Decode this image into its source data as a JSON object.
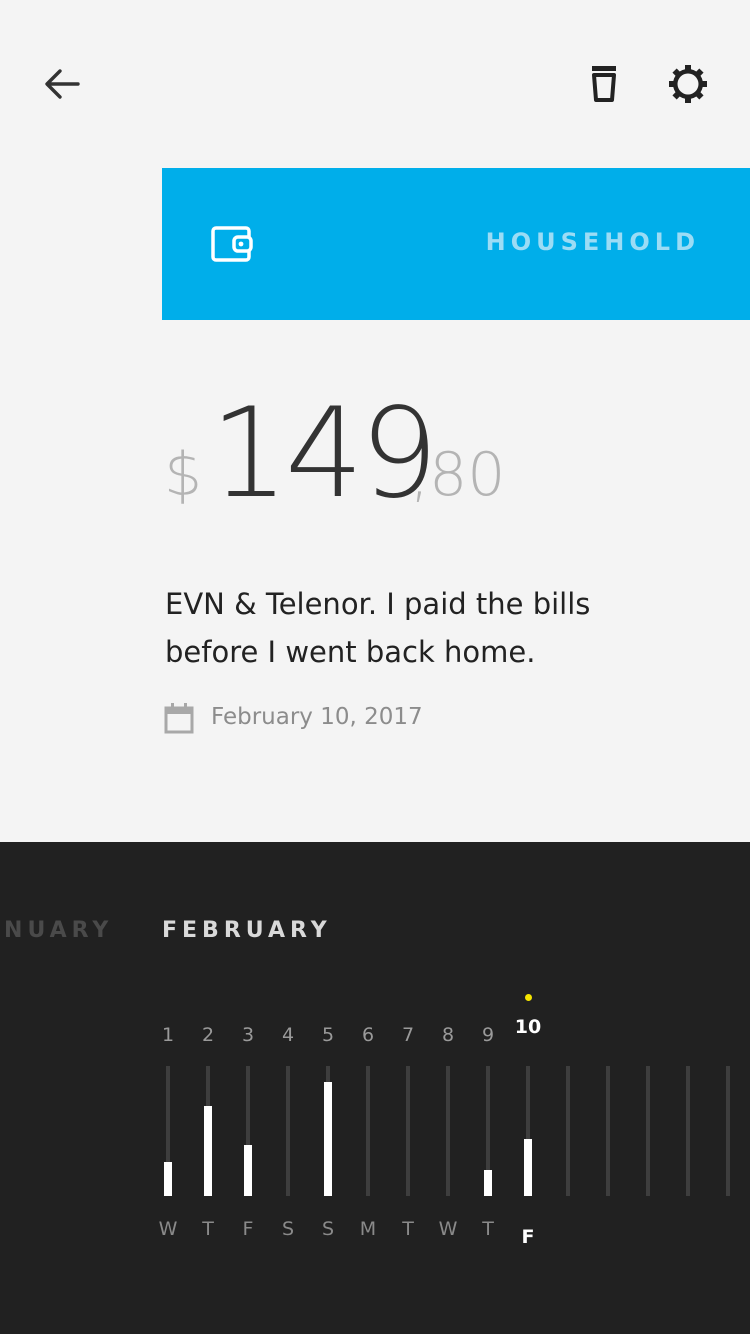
{
  "header": {
    "back_icon": "arrow-left-icon",
    "delete_icon": "trash-icon",
    "settings_icon": "gear-icon"
  },
  "category": {
    "label": "HOUSEHOLD",
    "icon": "wallet-icon",
    "color": "#00aeea"
  },
  "amount": {
    "currency": "$",
    "major": "149",
    "minor": ",80"
  },
  "note": "EVN & Telenor. I paid the bills before I went back home.",
  "date": {
    "icon": "calendar-icon",
    "text": "February 10, 2017"
  },
  "timeline": {
    "prev_month": "ANUARY",
    "current_month": "FEBRUARY",
    "accent": "#f5e500",
    "selected_day": "10",
    "days": [
      {
        "num": "1",
        "letter": "W",
        "level": 0.26
      },
      {
        "num": "2",
        "letter": "T",
        "level": 0.69
      },
      {
        "num": "3",
        "letter": "F",
        "level": 0.39
      },
      {
        "num": "4",
        "letter": "S",
        "level": 0
      },
      {
        "num": "5",
        "letter": "S",
        "level": 0.88
      },
      {
        "num": "6",
        "letter": "M",
        "level": 0
      },
      {
        "num": "7",
        "letter": "T",
        "level": 0
      },
      {
        "num": "8",
        "letter": "W",
        "level": 0
      },
      {
        "num": "9",
        "letter": "T",
        "level": 0.2
      },
      {
        "num": "10",
        "letter": "F",
        "level": 0.44
      },
      {
        "num": "",
        "letter": "",
        "level": 0
      },
      {
        "num": "",
        "letter": "",
        "level": 0
      },
      {
        "num": "",
        "letter": "",
        "level": 0
      },
      {
        "num": "",
        "letter": "",
        "level": 0
      },
      {
        "num": "",
        "letter": "",
        "level": 0
      }
    ]
  }
}
